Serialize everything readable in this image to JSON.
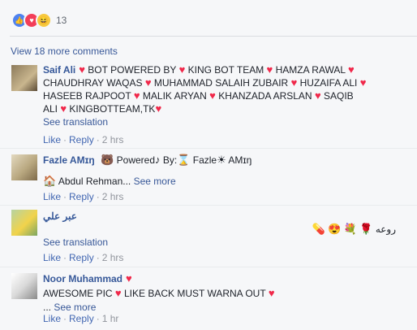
{
  "reactions": {
    "count": "13"
  },
  "view_more": "View 18 more comments",
  "comments": [
    {
      "author": "Saif Ali",
      "segments": [
        "BOT POWERED BY",
        "KING BOT TEAM",
        "HAMZA RAWAL",
        "CHAUDHRAY WAQAS",
        "MUHAMMAD SALAIH ZUBAIR",
        "HUZAIFA ALI",
        "HASEEB RAJPOOT",
        "MALIK ARYAN",
        "KHANZADA ARSLAN",
        "SAQIB",
        "ALI",
        "KINGBOTTEAM,TK"
      ],
      "see_translation": "See translation",
      "like": "Like",
      "reply": "Reply",
      "time": "2 hrs"
    },
    {
      "author": "Fazle AMɪŋ",
      "line1": {
        "powered": "Powered",
        "by": "By:",
        "name": "Fazle",
        "amin": "AMɪŋ"
      },
      "line2": "Abdul Rehman...",
      "see_more": "See more",
      "like": "Like",
      "reply": "Reply",
      "time": "2 hrs"
    },
    {
      "author": "عبر علي",
      "rtl_text": "روعه",
      "see_translation": "See translation",
      "like": "Like",
      "reply": "Reply",
      "time": "2 hrs"
    },
    {
      "author": "Noor Muhammad",
      "segments": [
        "AWESOME PIC",
        "LIKE BACK MUST WARNA OUT"
      ],
      "ellipsis": "...",
      "see_more": "See more",
      "like": "Like",
      "reply": "Reply",
      "time": "1 hr"
    }
  ]
}
